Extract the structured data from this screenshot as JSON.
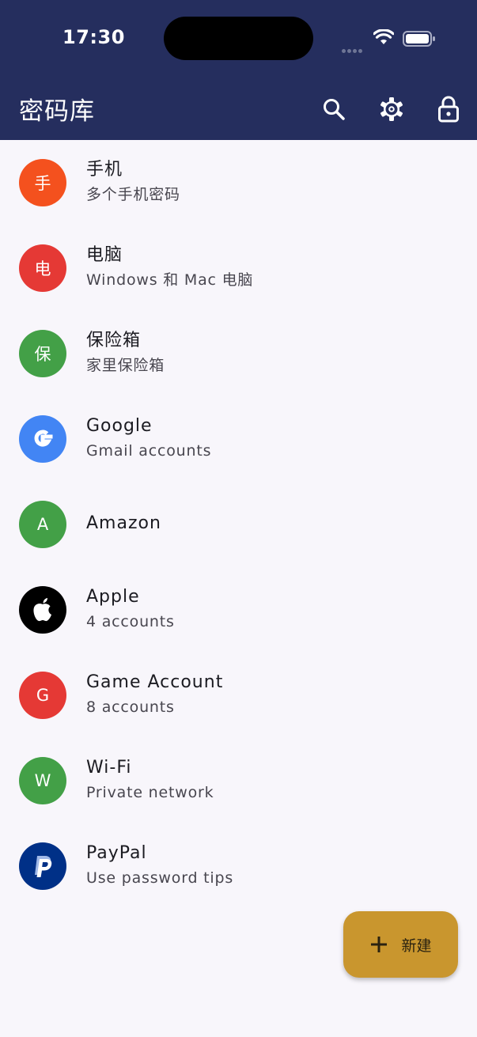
{
  "status_bar": {
    "time": "17:30"
  },
  "app_bar": {
    "title": "密码库",
    "actions": [
      {
        "icon": "search-icon"
      },
      {
        "icon": "gear-icon"
      },
      {
        "icon": "lock-icon"
      }
    ]
  },
  "items": [
    {
      "title": "手机",
      "subtitle": "多个手机密码",
      "avatar_text": "手",
      "avatar_color": "#f4511e",
      "icon": "letter"
    },
    {
      "title": "电脑",
      "subtitle": "Windows 和 Mac 电脑",
      "avatar_text": "电",
      "avatar_color": "#e53935",
      "icon": "letter"
    },
    {
      "title": "保险箱",
      "subtitle": "家里保险箱",
      "avatar_text": "保",
      "avatar_color": "#43a047",
      "icon": "letter"
    },
    {
      "title": "Google",
      "subtitle": "Gmail accounts",
      "avatar_text": "",
      "avatar_color": "#4285f4",
      "icon": "google-logo-icon"
    },
    {
      "title": "Amazon",
      "subtitle": "",
      "avatar_text": "A",
      "avatar_color": "#43a047",
      "icon": "letter"
    },
    {
      "title": "Apple",
      "subtitle": "4 accounts",
      "avatar_text": "",
      "avatar_color": "#000000",
      "icon": "apple-logo-icon"
    },
    {
      "title": "Game Account",
      "subtitle": "8 accounts",
      "avatar_text": "G",
      "avatar_color": "#e53935",
      "icon": "letter"
    },
    {
      "title": "Wi-Fi",
      "subtitle": "Private network",
      "avatar_text": "W",
      "avatar_color": "#43a047",
      "icon": "letter"
    },
    {
      "title": "PayPal",
      "subtitle": "Use password tips",
      "avatar_text": "",
      "avatar_color": "#003087",
      "icon": "paypal-logo-icon"
    }
  ],
  "fab": {
    "label": "新建",
    "icon": "plus-icon",
    "color": "#c9962e"
  },
  "colors": {
    "app_bar": "#252e5e",
    "background": "#f8f6fb"
  }
}
